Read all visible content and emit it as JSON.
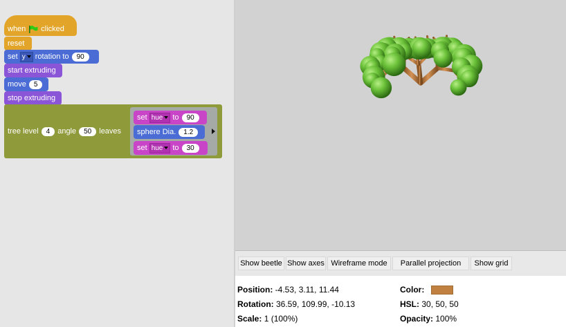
{
  "script": {
    "hat": {
      "when": "when",
      "clicked": "clicked"
    },
    "reset": "reset",
    "set_rotation": {
      "set": "set",
      "axis": "y",
      "rotation_to": "rotation to",
      "value": "90"
    },
    "start_extruding": "start extruding",
    "move": {
      "label": "move",
      "value": "5"
    },
    "stop_extruding": "stop extruding",
    "tree": {
      "label": "tree level",
      "level": "4",
      "angle_label": "angle",
      "angle": "50",
      "leaves_label": "leaves"
    },
    "leaves": {
      "set1": {
        "set": "set",
        "prop": "hue",
        "to": "to",
        "value": "90"
      },
      "sphere": {
        "label": "sphere Dia.",
        "value": "1.2"
      },
      "set2": {
        "set": "set",
        "prop": "hue",
        "to": "to",
        "value": "30"
      }
    }
  },
  "buttons": {
    "show_beetle": "Show beetle",
    "show_axes": "Show axes",
    "wireframe": "Wireframe mode",
    "parallel": "Parallel projection",
    "show_grid": "Show grid"
  },
  "info": {
    "position_label": "Position:",
    "position": "-4.53, 3.11, 11.44",
    "rotation_label": "Rotation:",
    "rotation": "36.59, 109.99, -10.13",
    "scale_label": "Scale:",
    "scale": "1 (100%)",
    "color_label": "Color:",
    "color_swatch": "#c0803f",
    "hsl_label": "HSL:",
    "hsl": "30, 50, 50",
    "opacity_label": "Opacity:",
    "opacity": "100%"
  },
  "colors": {
    "trunk": "#b8753a",
    "leaf": "#6cc23a",
    "flag": "#2fcb14"
  }
}
